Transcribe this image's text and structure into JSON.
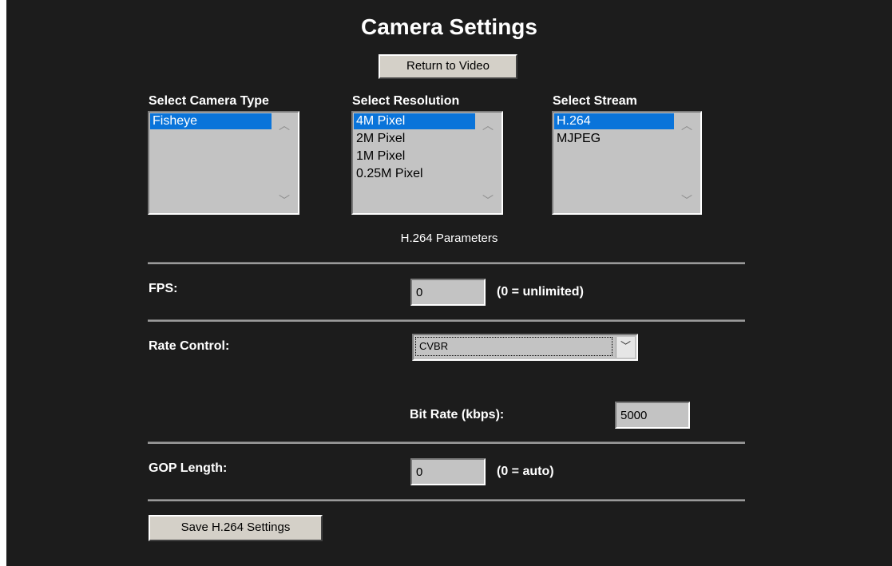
{
  "header": {
    "title": "Camera Settings",
    "return_label": "Return to Video"
  },
  "selectors": {
    "camera_type": {
      "label": "Select Camera Type",
      "options": [
        "Fisheye"
      ],
      "selected": "Fisheye"
    },
    "resolution": {
      "label": "Select Resolution",
      "options": [
        "4M Pixel",
        "2M Pixel",
        "1M Pixel",
        "0.25M Pixel"
      ],
      "selected": "4M Pixel"
    },
    "stream": {
      "label": "Select Stream",
      "options": [
        "H.264",
        "MJPEG"
      ],
      "selected": "H.264"
    }
  },
  "parameters": {
    "section_title": "H.264 Parameters",
    "fps": {
      "label": "FPS:",
      "value": "0",
      "hint": "(0 = unlimited)"
    },
    "rate_control": {
      "label": "Rate Control:",
      "value": "CVBR"
    },
    "bit_rate": {
      "label": "Bit Rate (kbps):",
      "value": "5000"
    },
    "gop_length": {
      "label": "GOP Length:",
      "value": "0",
      "hint": "(0 = auto)"
    }
  },
  "footer": {
    "save_label": "Save H.264 Settings"
  },
  "icons": {
    "scroll_up": "chevron-up-icon",
    "scroll_down": "chevron-down-icon",
    "select_arrow": "chevron-down-icon"
  },
  "colors": {
    "background": "#1c1c1c",
    "selection": "#0a74da",
    "control_gray": "#c3c3c3"
  }
}
